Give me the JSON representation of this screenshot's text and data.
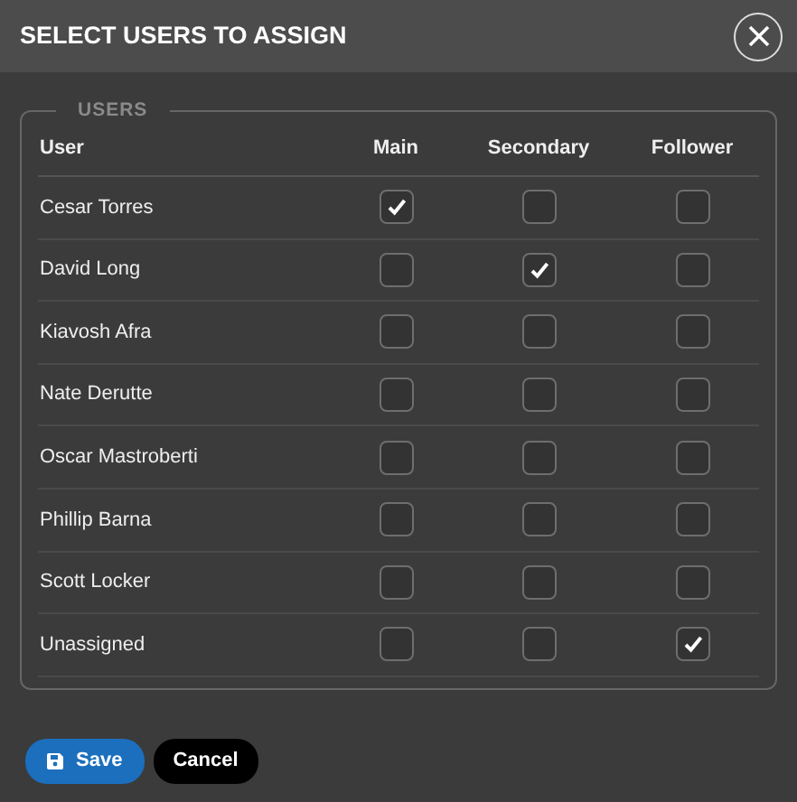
{
  "dialog": {
    "title": "SELECT USERS TO ASSIGN"
  },
  "users": {
    "legend": "USERS",
    "columns": [
      "User",
      "Main",
      "Secondary",
      "Follower"
    ],
    "rows": [
      {
        "name": "Cesar Torres",
        "main": true,
        "secondary": false,
        "follower": false
      },
      {
        "name": "David Long",
        "main": false,
        "secondary": true,
        "follower": false
      },
      {
        "name": "Kiavosh Afra",
        "main": false,
        "secondary": false,
        "follower": false
      },
      {
        "name": "Nate Derutte",
        "main": false,
        "secondary": false,
        "follower": false
      },
      {
        "name": "Oscar Mastroberti",
        "main": false,
        "secondary": false,
        "follower": false
      },
      {
        "name": "Phillip Barna",
        "main": false,
        "secondary": false,
        "follower": false
      },
      {
        "name": "Scott Locker",
        "main": false,
        "secondary": false,
        "follower": false
      },
      {
        "name": "Unassigned",
        "main": false,
        "secondary": false,
        "follower": true
      }
    ]
  },
  "buttons": [
    {
      "kind": "save",
      "label": "Save"
    },
    {
      "kind": "cancel",
      "label": "Cancel"
    }
  ]
}
